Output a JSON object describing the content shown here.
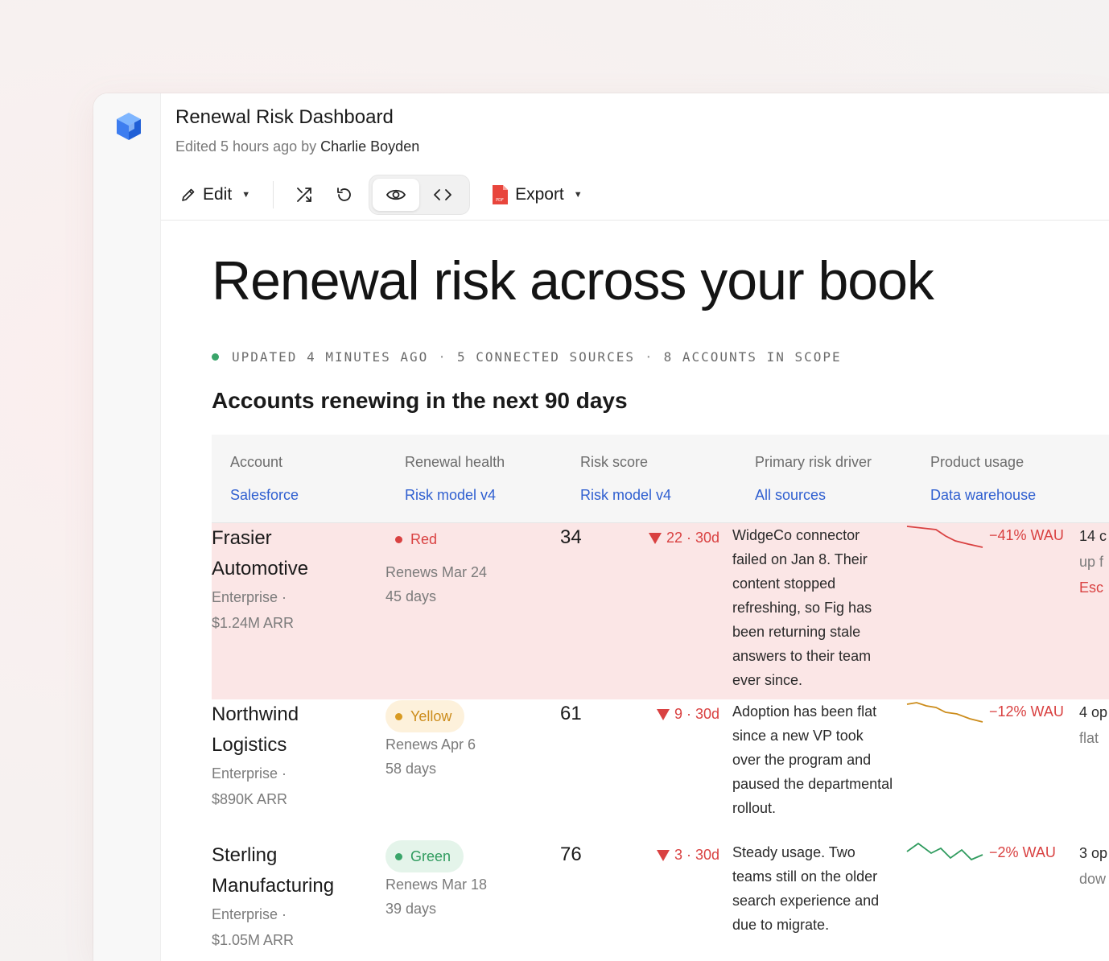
{
  "app": {
    "title": "Renewal Risk Dashboard",
    "edited_prefix": "Edited 5 hours ago by",
    "edited_by": "Charlie Boyden",
    "logo_icon": "cube-icon"
  },
  "toolbar": {
    "edit_label": "Edit",
    "export_label": "Export",
    "icons": [
      "pencil-icon",
      "shuffle-icon",
      "undo-icon",
      "eye-icon",
      "code-icon",
      "pdf-icon"
    ],
    "active_view": "preview"
  },
  "page": {
    "heading": "Renewal risk across your book",
    "meta": {
      "updated": "UPDATED 4 MINUTES AGO",
      "sources": "5 CONNECTED SOURCES",
      "scope": "8 ACCOUNTS IN SCOPE",
      "separator": "·"
    },
    "section_title": "Accounts renewing in the next 90 days"
  },
  "table": {
    "columns": [
      {
        "label": "Account",
        "source": "Salesforce"
      },
      {
        "label": "Renewal health",
        "source": "Risk model v4"
      },
      {
        "label": "Risk score",
        "source": "Risk model v4"
      },
      {
        "label": "Primary risk driver",
        "source": "All sources"
      },
      {
        "label": "Product usage",
        "source": "Data warehouse"
      }
    ],
    "rows": [
      {
        "name_line1": "Frasier",
        "name_line2": "Automotive",
        "tier": "Enterprise ·",
        "arr": "$1.24M ARR",
        "health": "Red",
        "renews": "Renews Mar 24",
        "days": "45 days",
        "score": "34",
        "delta": "22 · 30d",
        "driver": "WidgeCo connector failed on Jan 8. Their content stopped refreshing, so Fig has been returning stale answers to their team ever since.",
        "wau": "−41% WAU",
        "next_line1": "14 c",
        "next_line2": "up f",
        "next_line3": "Esc"
      },
      {
        "name_line1": "Northwind",
        "name_line2": "Logistics",
        "tier": "Enterprise ·",
        "arr": "$890K ARR",
        "health": "Yellow",
        "renews": "Renews Apr 6",
        "days": "58 days",
        "score": "61",
        "delta": "9 · 30d",
        "driver": "Adoption has been flat since a new VP took over the program and paused the departmental rollout.",
        "wau": "−12% WAU",
        "next_line1": "4 op",
        "next_line2": "flat"
      },
      {
        "name_line1": "Sterling",
        "name_line2": "Manufacturing",
        "tier": "Enterprise ·",
        "arr": "$1.05M ARR",
        "health": "Green",
        "renews": "Renews Mar 18",
        "days": "39 days",
        "score": "76",
        "delta": "3 · 30d",
        "driver": "Steady usage. Two teams still on the older search experience and due to migrate.",
        "wau": "−2% WAU",
        "next_line1": "3 op",
        "next_line2": "dow"
      }
    ]
  },
  "colors": {
    "red": "#d94141",
    "yellow": "#cc8c1b",
    "green": "#2f9b5e",
    "link": "#2f5fd0",
    "red_row_bg": "#fbe6e6"
  }
}
